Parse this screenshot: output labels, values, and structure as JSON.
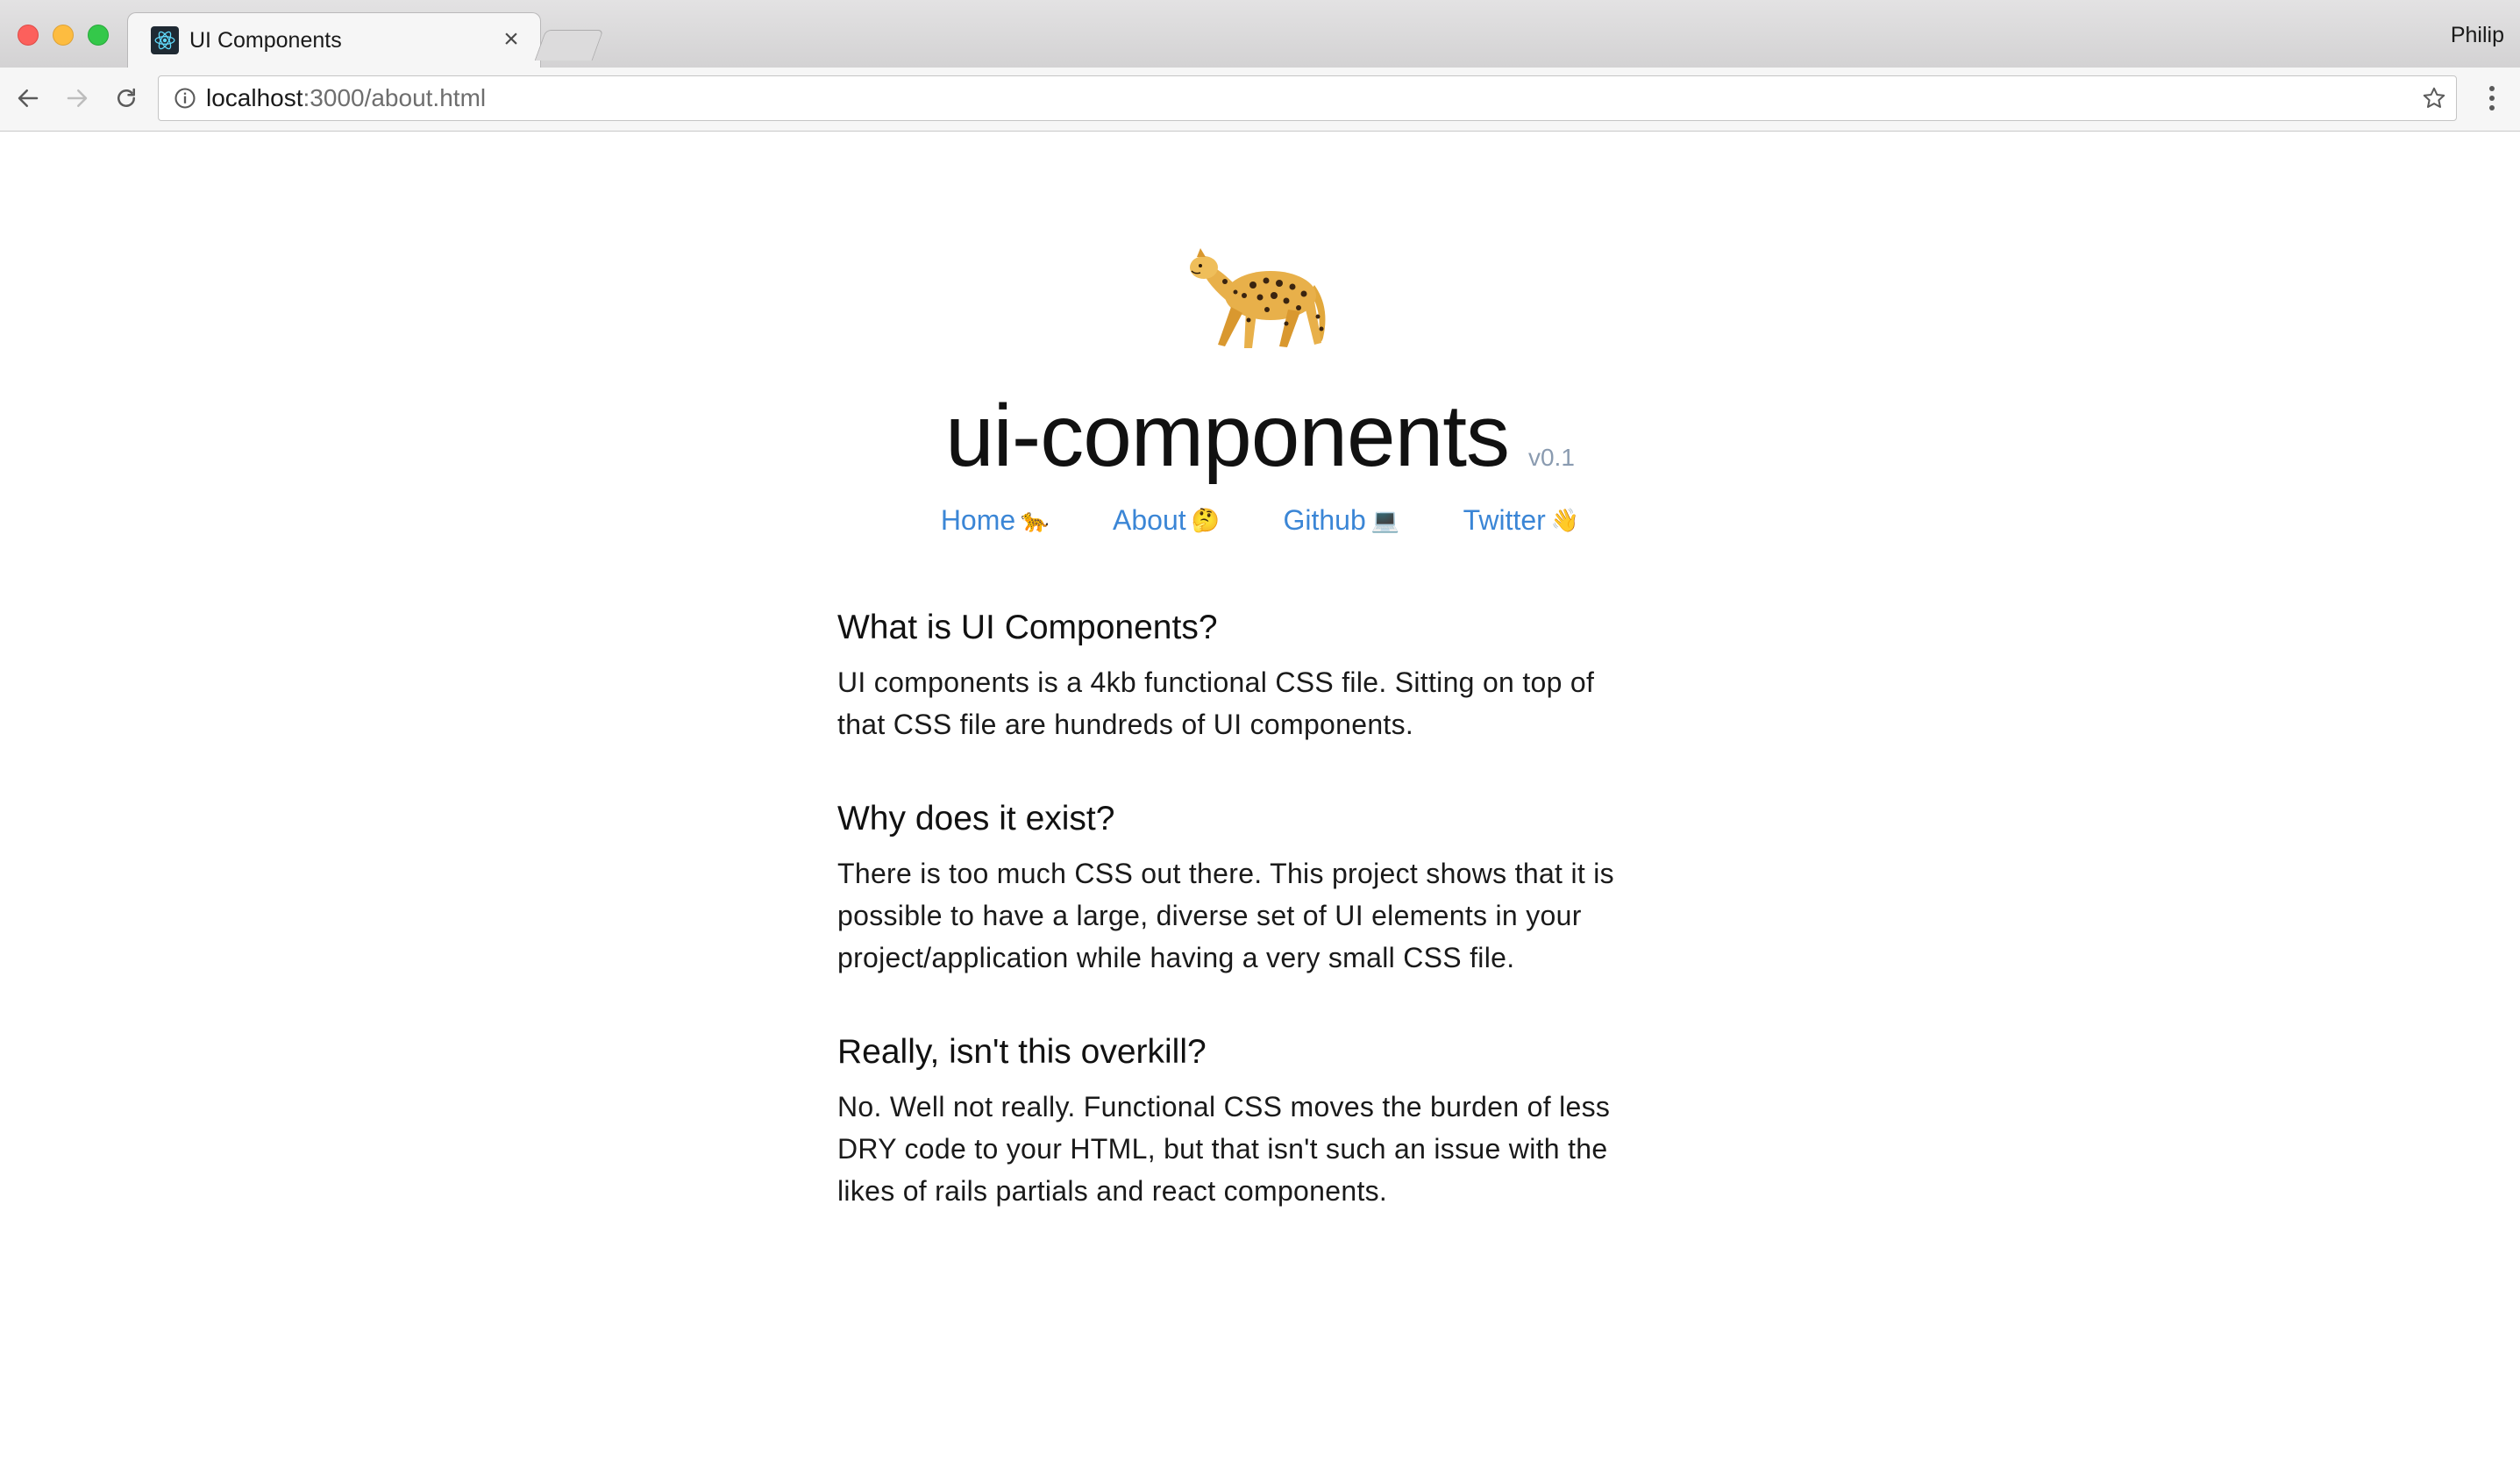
{
  "browser": {
    "tab_title": "UI Components",
    "tab_close": "×",
    "profile": "Philip",
    "url_host": "localhost",
    "url_path": ":3000/about.html"
  },
  "hero": {
    "logo": "cheetah-icon",
    "title": "ui-components",
    "version": "v0.1"
  },
  "nav": [
    {
      "label": "Home",
      "emoji": "🐆"
    },
    {
      "label": "About",
      "emoji": "🤔"
    },
    {
      "label": "Github",
      "emoji": "💻"
    },
    {
      "label": "Twitter",
      "emoji": "👋"
    }
  ],
  "sections": [
    {
      "heading": "What is UI Components?",
      "lines": [
        "UI components is a 4kb functional CSS file. Sitting on top of",
        "that CSS file are hundreds of UI components."
      ]
    },
    {
      "heading": "Why does it exist?",
      "lines": [
        "There is too much CSS out there. This project shows that it is",
        "possible to have a large, diverse set of UI elements in your",
        "project/application while having a very small CSS file."
      ]
    },
    {
      "heading": "Really, isn't this overkill?",
      "lines": [
        "No. Well not really. Functional CSS moves the burden of less",
        "DRY code to your HTML, but that isn't such an issue with the",
        "likes of rails partials and react components."
      ]
    }
  ],
  "colors": {
    "link": "#3b86d6",
    "version": "#8a9bb0",
    "text": "#1a1a1a"
  }
}
